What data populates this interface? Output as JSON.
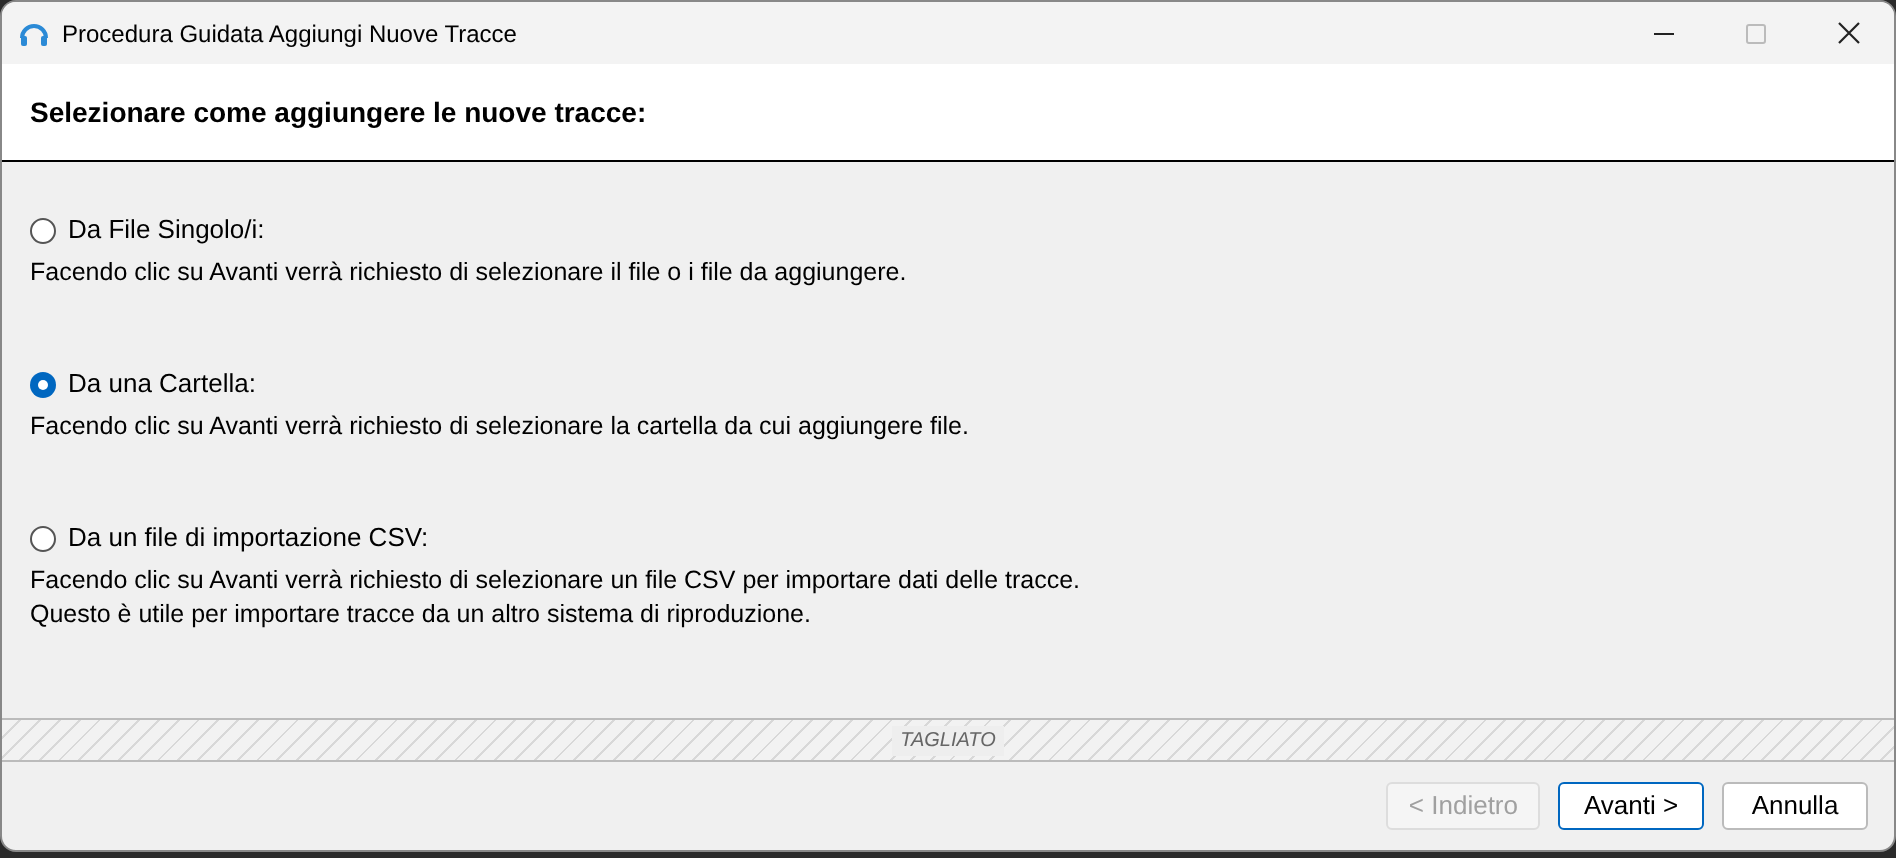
{
  "window": {
    "title": "Procedura Guidata Aggiungi Nuove Tracce"
  },
  "header": {
    "title": "Selezionare come aggiungere le nuove tracce:"
  },
  "options": [
    {
      "label": "Da File Singolo/i:",
      "selected": false,
      "description": [
        "Facendo clic su Avanti verrà richiesto di selezionare il file o i file da aggiungere."
      ]
    },
    {
      "label": "Da una Cartella:",
      "selected": true,
      "description": [
        "Facendo clic su Avanti verrà richiesto di selezionare la cartella da cui aggiungere file."
      ]
    },
    {
      "label": "Da un file di importazione CSV:",
      "selected": false,
      "description": [
        "Facendo clic su Avanti verrà richiesto di selezionare un file CSV per importare dati delle tracce.",
        "Questo è utile per importare tracce da un altro sistema di riproduzione."
      ]
    }
  ],
  "cut_marker": "TAGLIATO",
  "buttons": [
    {
      "label": "< Indietro",
      "disabled": true,
      "default": false
    },
    {
      "label": "Avanti >",
      "disabled": false,
      "default": true
    },
    {
      "label": "Annulla",
      "disabled": false,
      "default": false
    }
  ]
}
